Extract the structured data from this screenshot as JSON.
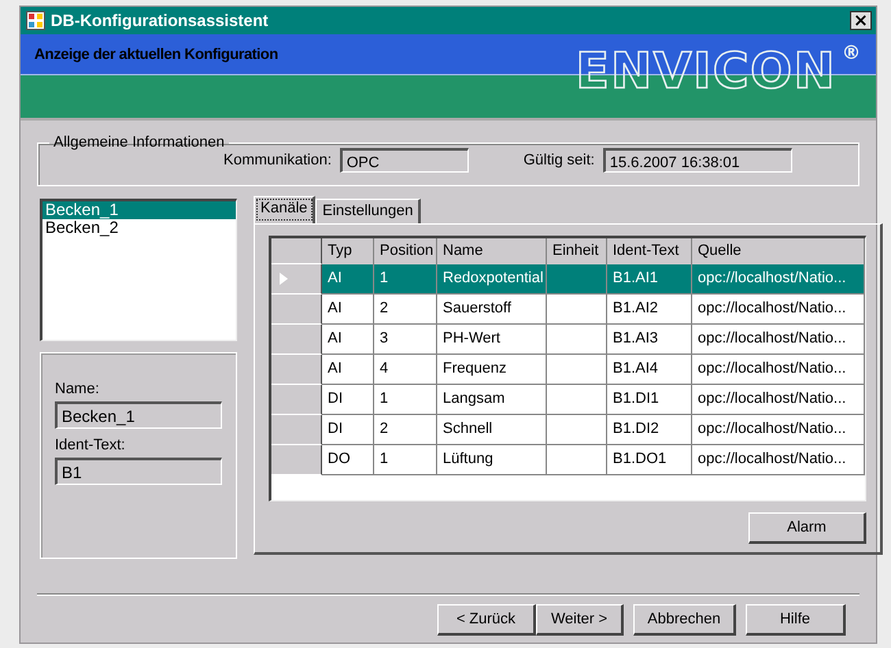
{
  "window": {
    "title": "DB-Konfigurationsassistent",
    "close": "×"
  },
  "header": {
    "subtitle": "Anzeige der aktuellen Konfiguration",
    "logo": "ENVICON",
    "logo_mark": "®"
  },
  "general": {
    "legend": "Allgemeine Informationen",
    "fields": [
      {
        "label": "Kommunikation:",
        "value": "OPC"
      },
      {
        "label": "Gültig seit:",
        "value": "15.6.2007 16:38:01"
      }
    ]
  },
  "basins": [
    {
      "label": "Becken_1",
      "selected": true
    },
    {
      "label": "Becken_2",
      "selected": false
    }
  ],
  "details": [
    {
      "label": "Name:",
      "value": "Becken_1"
    },
    {
      "label": "Ident-Text:",
      "value": "B1"
    }
  ],
  "tabs": [
    {
      "label": "Kanäle",
      "selected": true
    },
    {
      "label": "Einstellungen",
      "selected": false
    }
  ],
  "table": {
    "columns": [
      "Typ",
      "Position",
      "Name",
      "Einheit",
      "Ident-Text",
      "Quelle"
    ],
    "rows": [
      {
        "cells": [
          "AI",
          "1",
          "Redoxpotential",
          "",
          "B1.AI1",
          "opc://localhost/Natio..."
        ],
        "selected": true
      },
      {
        "cells": [
          "AI",
          "2",
          "Sauerstoff",
          "",
          "B1.AI2",
          "opc://localhost/Natio..."
        ],
        "selected": false
      },
      {
        "cells": [
          "AI",
          "3",
          "PH-Wert",
          "",
          "B1.AI3",
          "opc://localhost/Natio..."
        ],
        "selected": false
      },
      {
        "cells": [
          "AI",
          "4",
          "Frequenz",
          "",
          "B1.AI4",
          "opc://localhost/Natio..."
        ],
        "selected": false
      },
      {
        "cells": [
          "DI",
          "1",
          "Langsam",
          "",
          "B1.DI1",
          "opc://localhost/Natio..."
        ],
        "selected": false
      },
      {
        "cells": [
          "DI",
          "2",
          "Schnell",
          "",
          "B1.DI2",
          "opc://localhost/Natio..."
        ],
        "selected": false
      },
      {
        "cells": [
          "DO",
          "1",
          "Lüftung",
          "",
          "B1.DO1",
          "opc://localhost/Natio..."
        ],
        "selected": false
      }
    ]
  },
  "alarm_button": "Alarm",
  "buttons": [
    "< Zurück",
    "Weiter >",
    "Abbrechen",
    "Hilfe"
  ]
}
